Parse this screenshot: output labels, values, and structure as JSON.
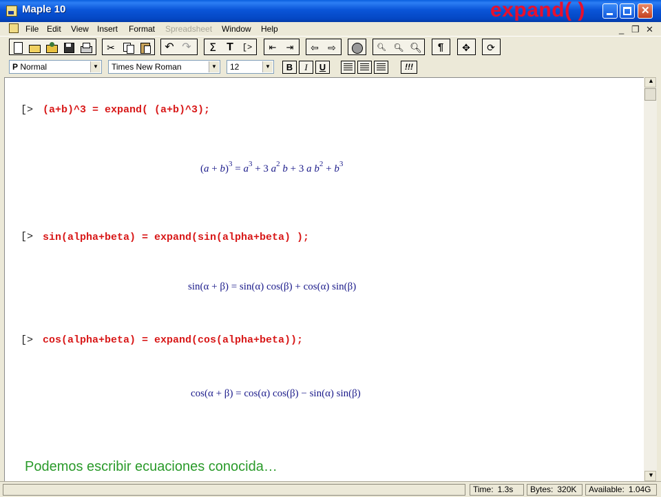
{
  "window": {
    "app_title": "Maple 10",
    "overlay_title": "expand( )"
  },
  "menu": {
    "items": [
      {
        "label": "File",
        "enabled": true
      },
      {
        "label": "Edit",
        "enabled": true
      },
      {
        "label": "View",
        "enabled": true
      },
      {
        "label": "Insert",
        "enabled": true
      },
      {
        "label": "Format",
        "enabled": true
      },
      {
        "label": "Spreadsheet",
        "enabled": false
      },
      {
        "label": "Window",
        "enabled": true
      },
      {
        "label": "Help",
        "enabled": true
      }
    ]
  },
  "toolbar_format": {
    "style_value": "Normal",
    "style_prefix": "P",
    "font_value": "Times New Roman",
    "size_value": "12",
    "bold": "B",
    "italic": "I",
    "underline": "U",
    "exec_label": "!!!"
  },
  "worksheet": {
    "prompt": "[>",
    "commands": [
      {
        "input": "(a+b)^3 = expand( (a+b)^3);",
        "output_html": "(<i>a</i> + <i>b</i>)<sup>3</sup> = <i>a</i><sup>3</sup> + 3 <i>a</i><sup>2</sup> <i>b</i> + 3 <i>a</i> <i>b</i><sup>2</sup> + <i>b</i><sup>3</sup>"
      },
      {
        "input": "sin(alpha+beta) = expand(sin(alpha+beta) );",
        "output_html": "sin(α + β) = sin(α) cos(β) + cos(α) sin(β)"
      },
      {
        "input": "cos(alpha+beta) = expand(cos(alpha+beta));",
        "output_html": "cos(α + β) = cos(α) cos(β) − sin(α) sin(β)"
      }
    ],
    "caption": "Podemos escribir ecuaciones conocida…"
  },
  "status": {
    "time_label": "Time:",
    "time_value": "1.3s",
    "bytes_label": "Bytes:",
    "bytes_value": "320K",
    "available_label": "Available:",
    "available_value": "1.04G"
  },
  "colors": {
    "title_gradient": "#0a55d8",
    "command_text": "#d81818",
    "caption_text": "#2a9a2a",
    "overlay_title": "#e8102e"
  }
}
